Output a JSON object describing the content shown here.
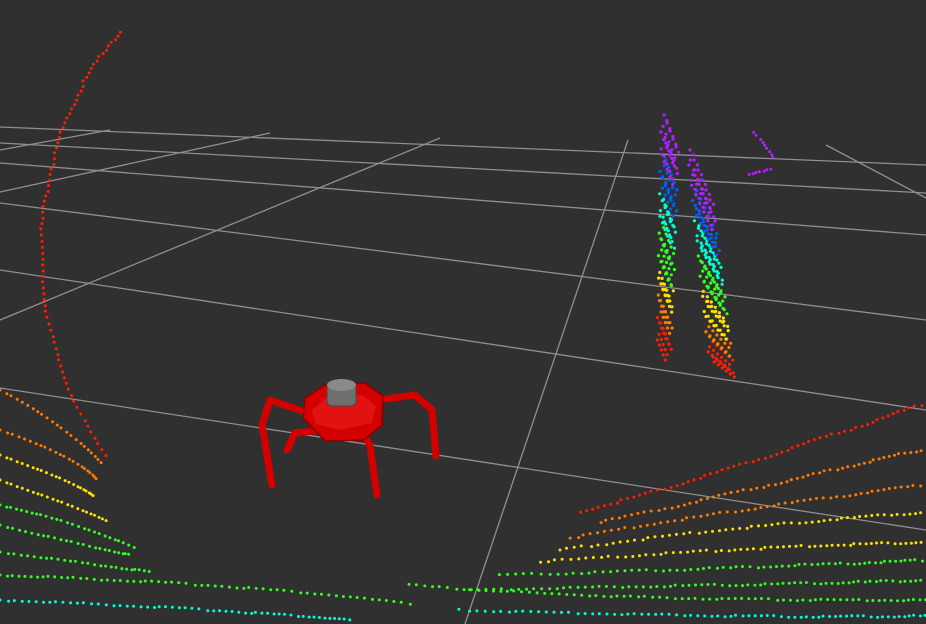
{
  "viewer": {
    "background": "#303030",
    "grid_color": "#a0a0a0",
    "robot": {
      "type": "hexapod",
      "body_color": "#d40000",
      "sensor_color": "#6f6f6f"
    },
    "point_cloud": {
      "colormap": "rainbow-by-height",
      "colors": [
        "#ff1e00",
        "#ff7a00",
        "#ffe000",
        "#30ff20",
        "#00ffd0",
        "#0060ff",
        "#b020ff"
      ]
    }
  }
}
